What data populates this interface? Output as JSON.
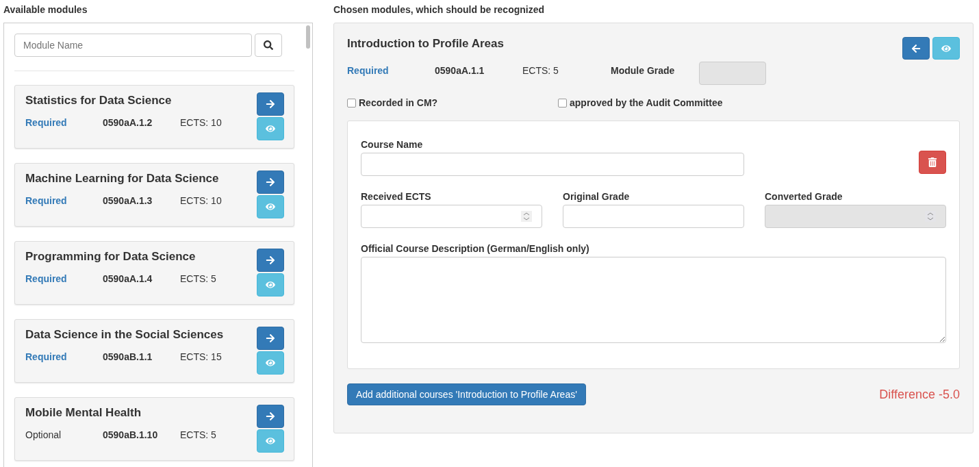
{
  "available": {
    "heading": "Available modules",
    "search": {
      "placeholder": "Module Name"
    },
    "modules": [
      {
        "title": "Statistics for Data Science",
        "kind": "required",
        "type": "Required",
        "code": "0590aA.1.2",
        "ects": "ECTS: 10"
      },
      {
        "title": "Machine Learning for Data Science",
        "kind": "required",
        "type": "Required",
        "code": "0590aA.1.3",
        "ects": "ECTS: 10"
      },
      {
        "title": "Programming for Data Science",
        "kind": "required",
        "type": "Required",
        "code": "0590aA.1.4",
        "ects": "ECTS: 5"
      },
      {
        "title": "Data Science in the Social Sciences",
        "kind": "required",
        "type": "Required",
        "code": "0590aB.1.1",
        "ects": "ECTS: 15"
      },
      {
        "title": "Mobile Mental Health",
        "kind": "optional",
        "type": "Optional",
        "code": "0590aB.1.10",
        "ects": "ECTS: 5"
      }
    ]
  },
  "chosen": {
    "heading": "Chosen modules, which should be recognized",
    "module": {
      "title": "Introduction to Profile Areas",
      "kind": "required",
      "type": "Required",
      "code": "0590aA.1.1",
      "ects": "ECTS: 5",
      "grade_label": "Module Grade",
      "grade_disabled": true,
      "checkboxes": [
        {
          "label": "Recorded in CM?",
          "checked": false
        },
        {
          "label": "approved by the Audit Committee",
          "checked": false
        }
      ],
      "course": {
        "name_label": "Course Name",
        "fields": [
          {
            "label": "Received ECTS",
            "kind": "number",
            "disabled": false
          },
          {
            "label": "Original Grade",
            "kind": "text",
            "disabled": false
          },
          {
            "label": "Converted Grade",
            "kind": "number",
            "disabled": true
          }
        ],
        "description_label": "Official Course Description (German/English only)"
      },
      "add_button": "Add additional courses 'Introduction to Profile Areas'",
      "difference": "Difference -5.0"
    }
  }
}
